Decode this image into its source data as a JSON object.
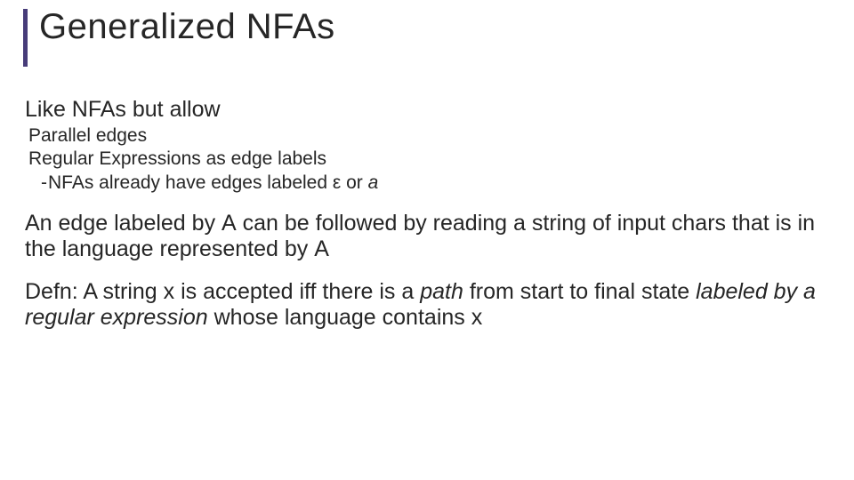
{
  "title": "Generalized NFAs",
  "intro": "Like NFAs but allow",
  "bullets": {
    "b1": "Parallel edges",
    "b2": "Regular Expressions as edge labels",
    "b3_prefix": "NFAs already have edges labeled ",
    "eps": "ε",
    "b3_or": " or ",
    "b3_a": "a"
  },
  "edge_para": {
    "p1": "An edge labeled by ",
    "A1": "A",
    "p2": " can be followed by reading a string of input chars that is in the language represented by ",
    "A2": "A"
  },
  "defn": {
    "d1": "Defn: A string x is accepted iff there is a ",
    "path": "path",
    "d2": " from start to final state ",
    "lbl": "labeled by a regular expression",
    "d3": " whose language contains x"
  }
}
